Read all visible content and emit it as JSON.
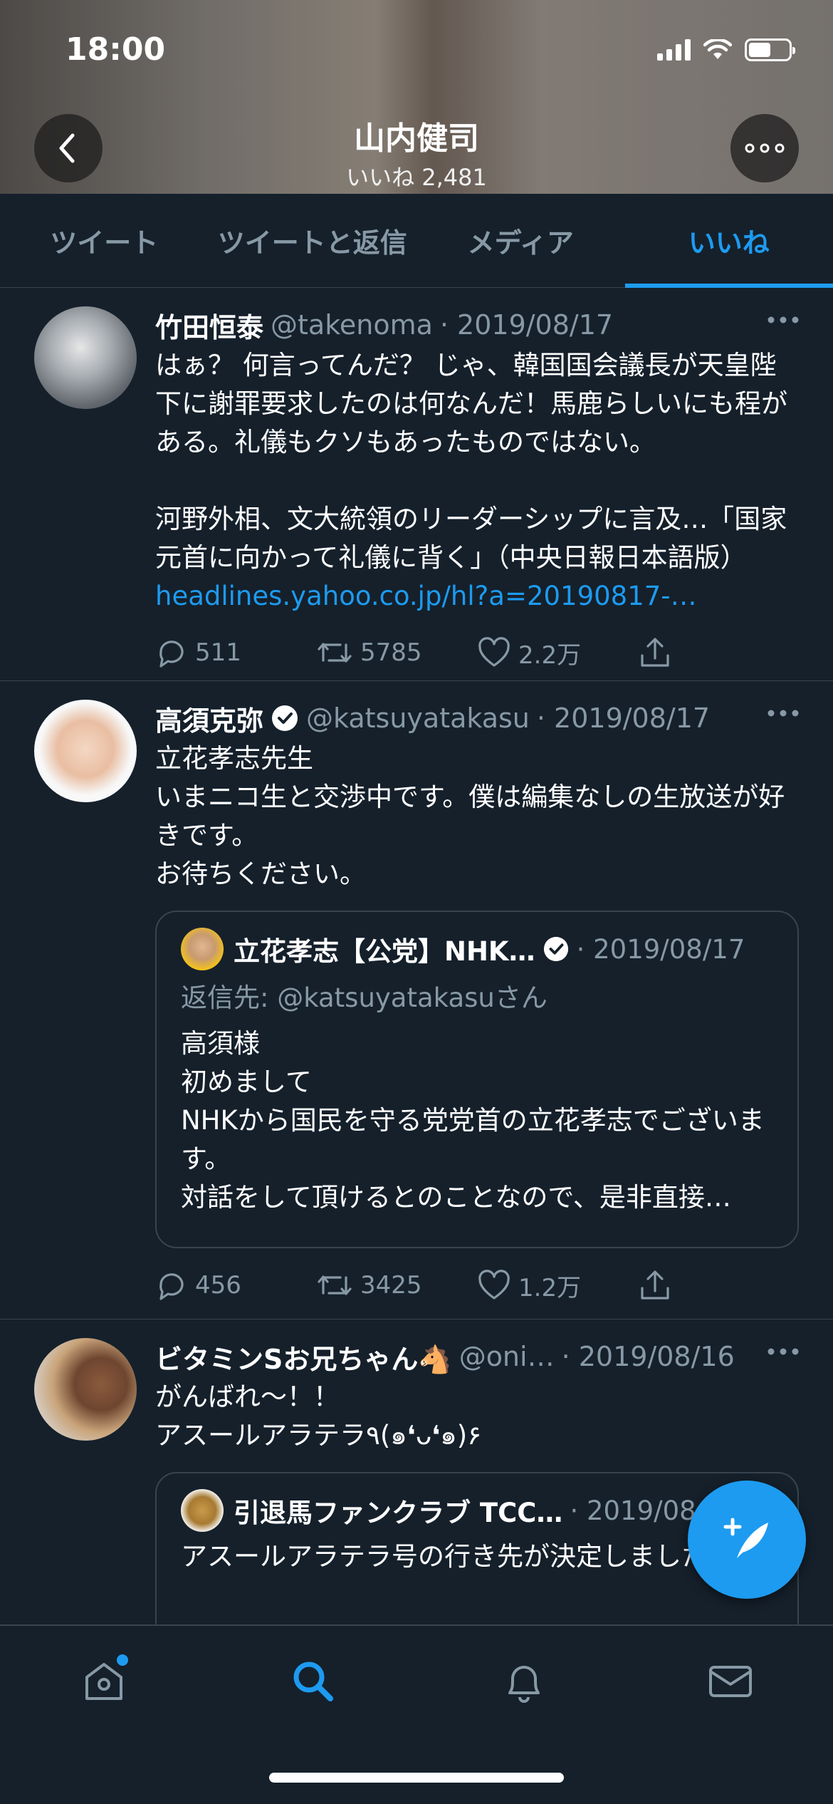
{
  "status_bar": {
    "time": "18:00"
  },
  "header": {
    "name": "山内健司",
    "likes": "いいね 2,481"
  },
  "tabs": [
    {
      "label": "ツイート"
    },
    {
      "label": "ツイートと返信"
    },
    {
      "label": "メディア"
    },
    {
      "label": "いいね"
    }
  ],
  "tweets": [
    {
      "name": "竹田恒泰",
      "handle": "@takenoma",
      "date": "· 2019/08/17",
      "body1": "はぁ？ 何言ってんだ？ じゃ、韓国国会議長が天皇陛下に謝罪要求したのは何なんだ！馬鹿らしいにも程がある。礼儀もクソもあったものではない。",
      "body2": "河野外相、文大統領のリーダーシップに言及…「国家元首に向かって礼儀に背く」（中央日報日本語版）",
      "link": "headlines.yahoo.co.jp/hl?a=20190817-…",
      "replies": "511",
      "retweets": "5785",
      "likes": "2.2万"
    },
    {
      "name": "高須克弥",
      "handle": "@katsuyatakasu",
      "date": "· 2019/08/17",
      "body1": "立花孝志先生",
      "body2": "いまニコ生と交渉中です。僕は編集なしの生放送が好きです。",
      "body3": "お待ちください。",
      "quote": {
        "name": "立花孝志【公党】NHK…",
        "date": "· 2019/08/17",
        "reply_to": "返信先: @katsuyatakasuさん",
        "line1": "高須様",
        "line2": "初めまして",
        "line3": "NHKから国民を守る党党首の立花孝志でございます。",
        "line4": "対話をして頂けるとのことなので、是非直接…"
      },
      "replies": "456",
      "retweets": "3425",
      "likes": "1.2万"
    },
    {
      "name": "ビタミンSお兄ちゃん🐴",
      "handle": "@oni…",
      "date": "· 2019/08/16",
      "body1": "がんばれ〜！！",
      "body2": "アスールアラテラ٩(๑❛ᴗ❛๑)۶",
      "quote": {
        "name": "引退馬ファンクラブ TCC…",
        "date": "· 2019/08/16",
        "line1": "アスールアラテラ号の行き先が決定しました"
      }
    }
  ],
  "icons": {
    "back": "chevron-left-icon",
    "more": "ellipsis-icon",
    "reply": "speech-bubble-icon",
    "retweet": "retweet-icon",
    "like": "heart-icon",
    "share": "share-icon",
    "compose": "feather-plus-icon",
    "home": "home-icon",
    "search": "search-icon",
    "notifications": "bell-icon",
    "messages": "envelope-icon"
  },
  "colors": {
    "accent": "#1d9bf0",
    "background": "#15202b",
    "muted": "#8899a6",
    "divider": "#38444d"
  }
}
